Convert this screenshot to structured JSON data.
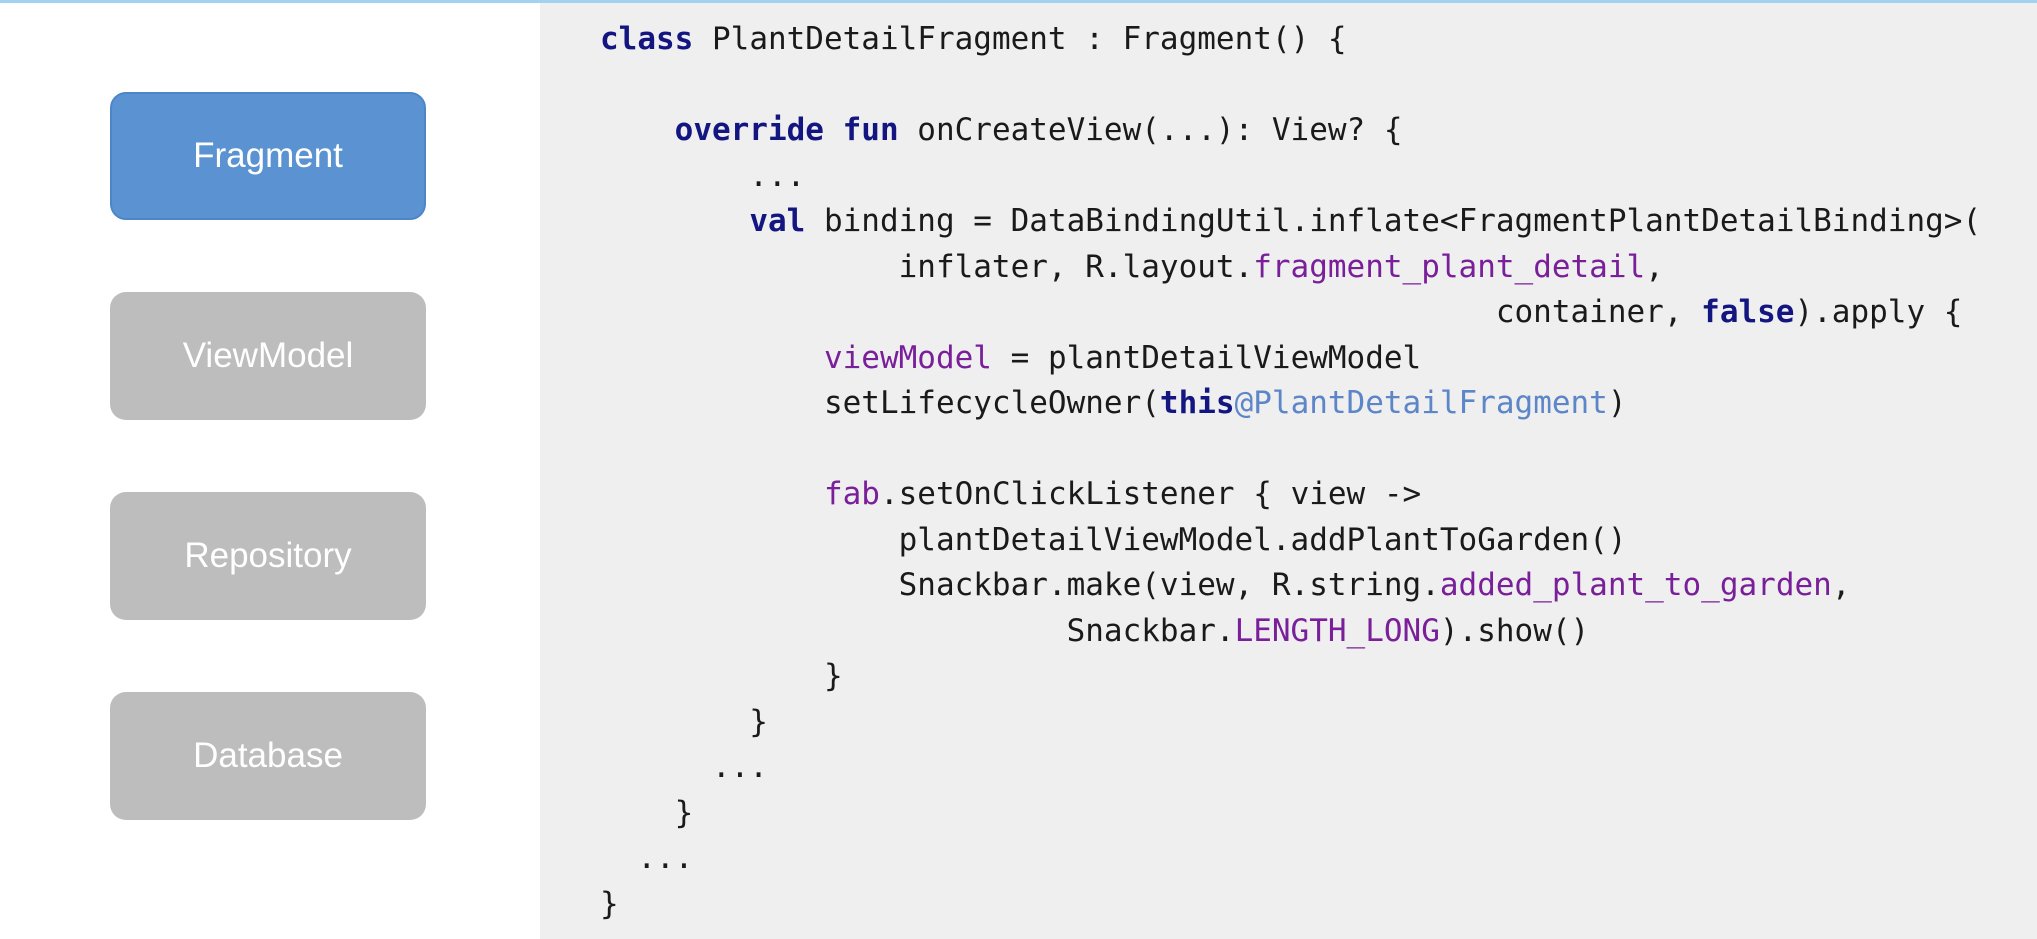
{
  "layers": [
    {
      "label": "Fragment",
      "active": true
    },
    {
      "label": "ViewModel",
      "active": false
    },
    {
      "label": "Repository",
      "active": false
    },
    {
      "label": "Database",
      "active": false
    }
  ],
  "code": {
    "lines": [
      [
        {
          "t": "class",
          "c": "kw"
        },
        {
          "t": " PlantDetailFragment : Fragment() {",
          "c": "pl"
        }
      ],
      [],
      [
        {
          "t": "    ",
          "c": "pl"
        },
        {
          "t": "override fun",
          "c": "kw"
        },
        {
          "t": " onCreateView(...): View? {",
          "c": "pl"
        }
      ],
      [
        {
          "t": "        ...",
          "c": "pl"
        }
      ],
      [
        {
          "t": "        ",
          "c": "pl"
        },
        {
          "t": "val",
          "c": "kw"
        },
        {
          "t": " binding = DataBindingUtil.inflate<FragmentPlantDetailBinding>(",
          "c": "pl"
        }
      ],
      [
        {
          "t": "                inflater, R.layout.",
          "c": "pl"
        },
        {
          "t": "fragment_plant_detail",
          "c": "pu"
        },
        {
          "t": ",",
          "c": "pl"
        }
      ],
      [
        {
          "t": "                                                container, ",
          "c": "pl"
        },
        {
          "t": "false",
          "c": "kw"
        },
        {
          "t": ").apply {",
          "c": "pl"
        }
      ],
      [
        {
          "t": "            ",
          "c": "pl"
        },
        {
          "t": "viewModel",
          "c": "pu"
        },
        {
          "t": " = plantDetailViewModel",
          "c": "pl"
        }
      ],
      [
        {
          "t": "            setLifecycleOwner(",
          "c": "pl"
        },
        {
          "t": "this",
          "c": "kw"
        },
        {
          "t": "@PlantDetailFragment",
          "c": "bl"
        },
        {
          "t": ")",
          "c": "pl"
        }
      ],
      [],
      [
        {
          "t": "            ",
          "c": "pl"
        },
        {
          "t": "fab",
          "c": "pu"
        },
        {
          "t": ".setOnClickListener { view ->",
          "c": "pl"
        }
      ],
      [
        {
          "t": "                plantDetailViewModel.addPlantToGarden()",
          "c": "pl"
        }
      ],
      [
        {
          "t": "                Snackbar.make(view, R.string.",
          "c": "pl"
        },
        {
          "t": "added_plant_to_garden",
          "c": "pu"
        },
        {
          "t": ",",
          "c": "pl"
        }
      ],
      [
        {
          "t": "                         Snackbar.",
          "c": "pl"
        },
        {
          "t": "LENGTH_LONG",
          "c": "pu"
        },
        {
          "t": ").show()",
          "c": "pl"
        }
      ],
      [
        {
          "t": "            }",
          "c": "pl"
        }
      ],
      [
        {
          "t": "        }",
          "c": "pl"
        }
      ],
      [
        {
          "t": "      ...",
          "c": "pl"
        }
      ],
      [
        {
          "t": "    }",
          "c": "pl"
        }
      ],
      [
        {
          "t": "  ...",
          "c": "pl"
        }
      ],
      [
        {
          "t": "}",
          "c": "pl"
        }
      ]
    ]
  },
  "colors": {
    "active_layer": "#5b93d2",
    "inactive_layer": "#bdbdbd",
    "code_background": "#efefef",
    "keyword": "#131680",
    "property": "#7a1f9a",
    "label_reference": "#5d86c9"
  }
}
